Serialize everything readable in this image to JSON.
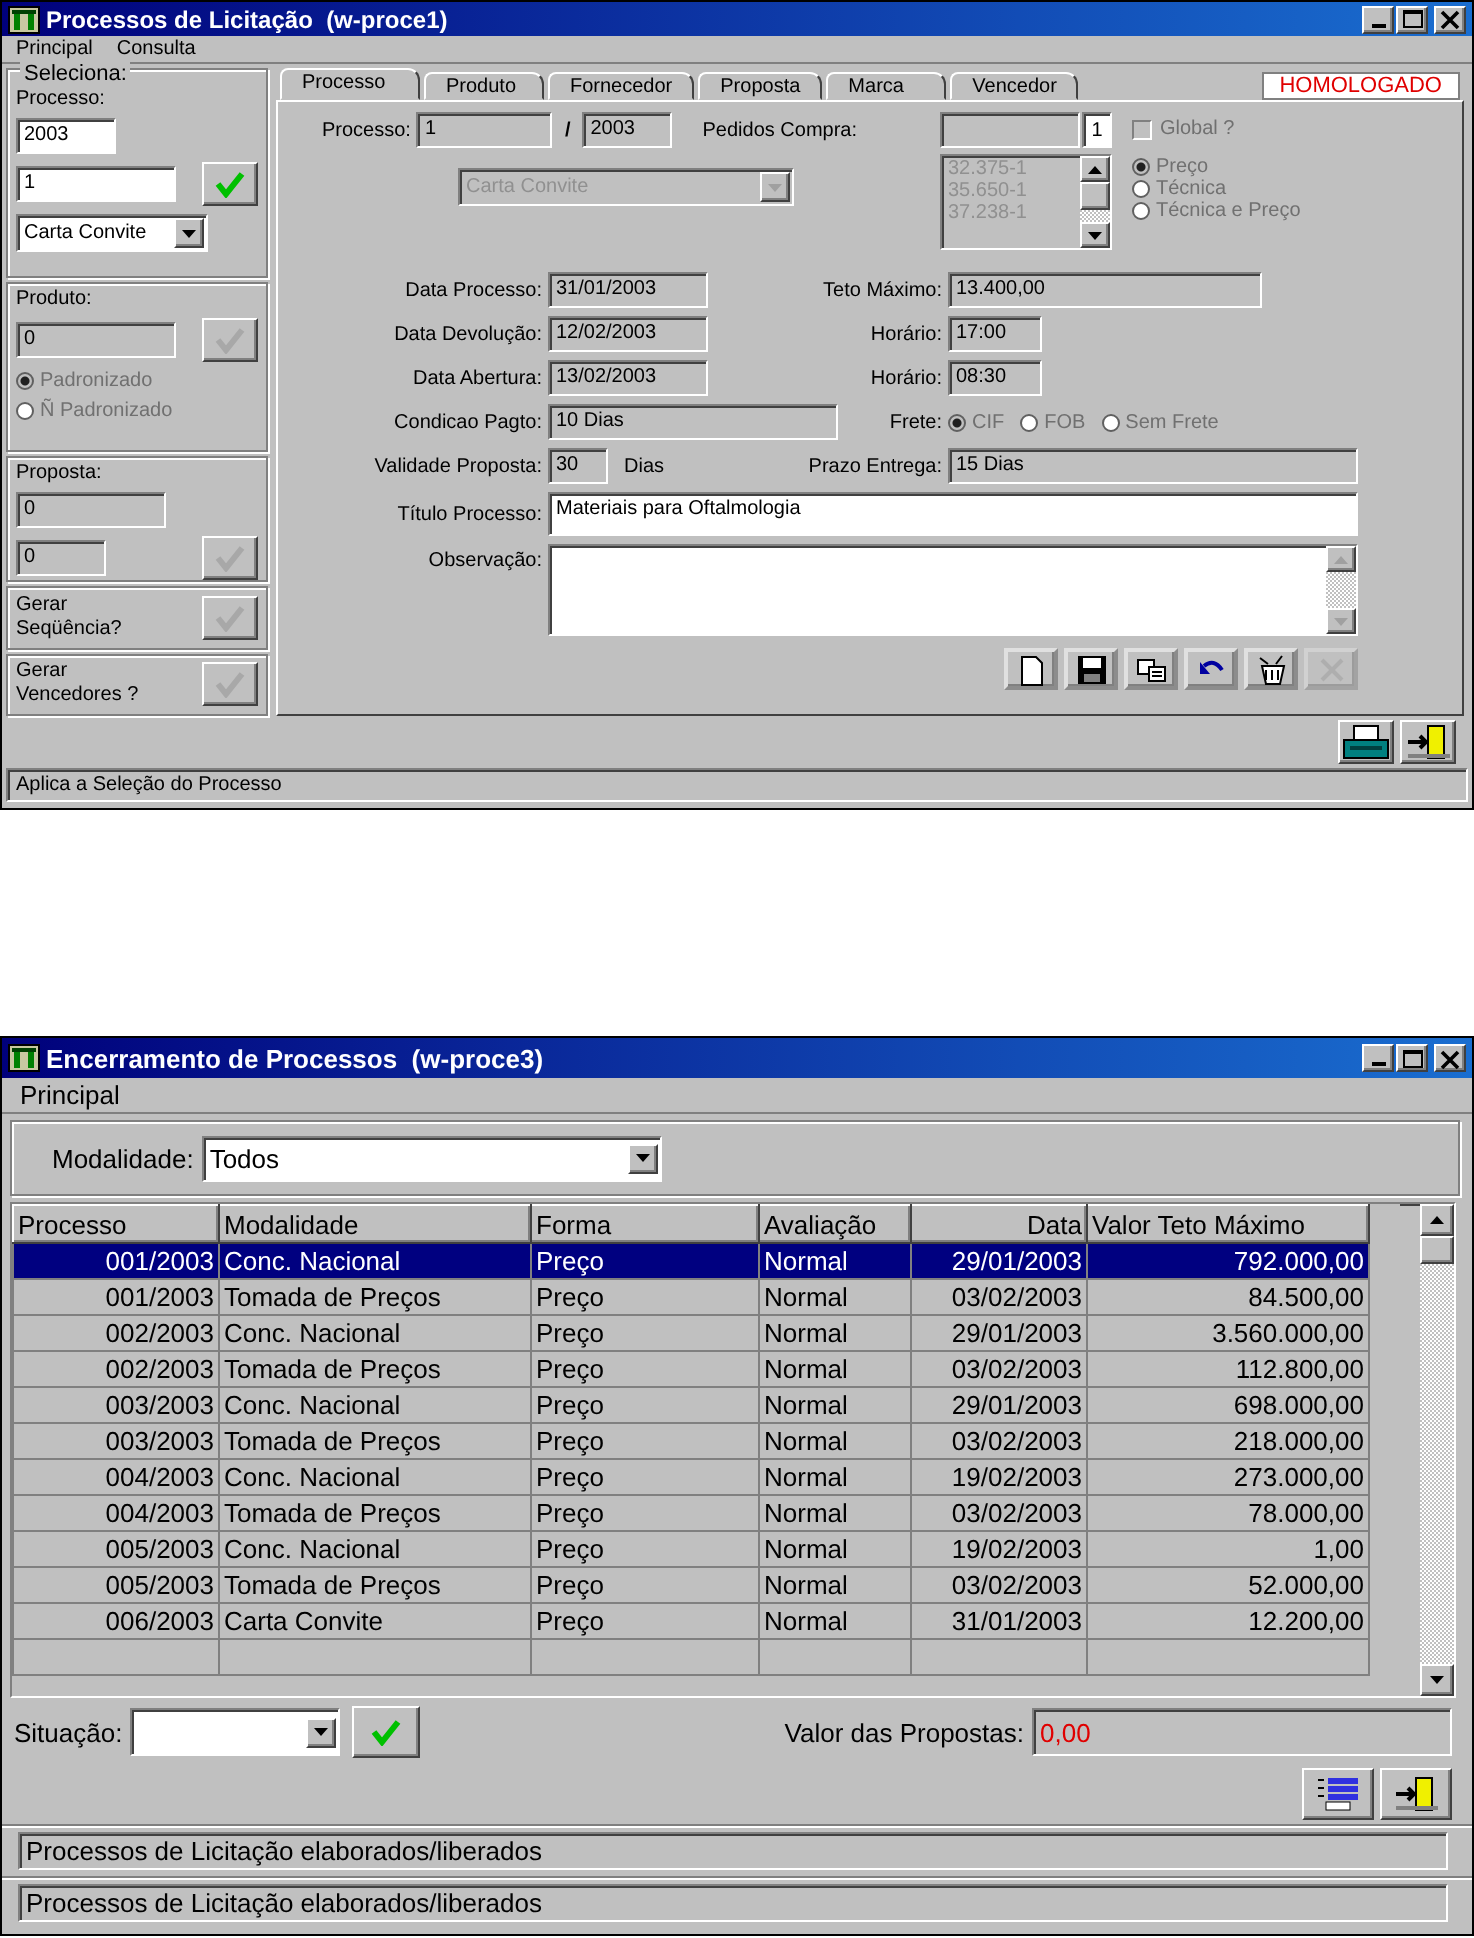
{
  "top_window": {
    "title": "Processos de Licitação  (w-proce1)",
    "menu": [
      "Principal",
      "Consulta"
    ],
    "select_panel": {
      "legend": "Seleciona:",
      "processo_label": "Processo:",
      "processo_value": "2003",
      "number_value": "1",
      "modalidade_value": "Carta Convite"
    },
    "produto_panel": {
      "label": "Produto:",
      "value": "0",
      "apply_disabled": true,
      "options": [
        {
          "label": "Padronizado",
          "selected": true
        },
        {
          "label": "Ñ Padronizado",
          "selected": false
        }
      ]
    },
    "proposta_panel": {
      "label": "Proposta:",
      "value_1": "0",
      "value_2": "0",
      "apply_disabled": true
    },
    "actions": [
      {
        "label": "Gerar\nSeqüência?",
        "disabled": true
      },
      {
        "label": "Gerar\nVencedores ?",
        "disabled": true
      }
    ],
    "tabs": [
      {
        "label": "Processo",
        "selected": true
      },
      {
        "label": "Produto",
        "selected": false
      },
      {
        "label": "Fornecedor",
        "selected": false
      },
      {
        "label": "Proposta",
        "selected": false
      },
      {
        "label": "Marca",
        "selected": false
      },
      {
        "label": "Vencedor",
        "selected": false
      }
    ],
    "status_badge": "HOMOLOGADO",
    "form": {
      "processo_label": "Processo:",
      "processo_number": "1",
      "separator": "/",
      "processo_year": "2003",
      "pedidos_label": "Pedidos Compra:",
      "pedidos_count": "1",
      "pedidos_list": [
        "32.375-1",
        "35.650-1",
        "37.238-1"
      ],
      "global": {
        "label": "Global ?",
        "checked": false
      },
      "modalidade": "Carta Convite",
      "avaliacao": [
        {
          "label": "Preço",
          "selected": true
        },
        {
          "label": "Técnica",
          "selected": false
        },
        {
          "label": "Técnica e Preço",
          "selected": false
        }
      ],
      "rows": [
        {
          "kind": "date",
          "label": "Data Processo:",
          "value": "31/01/2003",
          "right": {
            "kind": "money",
            "label": "Teto Máximo:",
            "value": "13.400,00"
          }
        },
        {
          "kind": "date",
          "label": "Data Devolução:",
          "value": "12/02/2003",
          "right": {
            "kind": "time",
            "label": "Horário:",
            "value": "17:00"
          }
        },
        {
          "kind": "date",
          "label": "Data Abertura:",
          "value": "13/02/2003",
          "right": {
            "kind": "time",
            "label": "Horário:",
            "value": "08:30"
          }
        },
        {
          "kind": "text",
          "label": "Condicao Pagto:",
          "value": "10 Dias",
          "right": {
            "kind": "radios",
            "label": "Frete:",
            "options": [
              {
                "label": "CIF",
                "selected": true
              },
              {
                "label": "FOB",
                "selected": false
              },
              {
                "label": "Sem Frete",
                "selected": false
              }
            ]
          }
        },
        {
          "kind": "days",
          "label": "Validade Proposta:",
          "value": "30",
          "unit": "Dias",
          "right": {
            "kind": "wide",
            "label": "Prazo Entrega:",
            "value": "15 Dias"
          }
        },
        {
          "kind": "title",
          "label": "Título Processo:",
          "value": "Materiais para Oftalmologia"
        },
        {
          "kind": "memo",
          "label": "Observação:"
        }
      ]
    },
    "toolbar": [
      {
        "kind": "new",
        "disabled": false
      },
      {
        "kind": "save",
        "disabled": false
      },
      {
        "kind": "copy",
        "disabled": false
      },
      {
        "kind": "undo",
        "disabled": false
      },
      {
        "kind": "delete",
        "disabled": false
      },
      {
        "kind": "cancel",
        "disabled": true
      }
    ],
    "footer_buttons": [
      {
        "kind": "print"
      },
      {
        "kind": "exit"
      }
    ],
    "status": "Aplica a Seleção do Processo"
  },
  "bottom_window": {
    "title": "Encerramento de Processos  (w-proce3)",
    "menu": [
      "Principal"
    ],
    "filter": {
      "label": "Modalidade:",
      "value": "Todos"
    },
    "columns": [
      "Processo",
      "Modalidade",
      "Forma",
      "Avaliação",
      "Data",
      "Valor Teto Máximo"
    ],
    "rows": [
      {
        "cells": [
          "001/2003",
          "Conc. Nacional",
          "Preço",
          "Normal",
          "29/01/2003",
          "792.000,00"
        ],
        "selected": true
      },
      {
        "cells": [
          "001/2003",
          "Tomada de Preços",
          "Preço",
          "Normal",
          "03/02/2003",
          "84.500,00"
        ],
        "selected": false
      },
      {
        "cells": [
          "002/2003",
          "Conc. Nacional",
          "Preço",
          "Normal",
          "29/01/2003",
          "3.560.000,00"
        ],
        "selected": false
      },
      {
        "cells": [
          "002/2003",
          "Tomada de Preços",
          "Preço",
          "Normal",
          "03/02/2003",
          "112.800,00"
        ],
        "selected": false
      },
      {
        "cells": [
          "003/2003",
          "Conc. Nacional",
          "Preço",
          "Normal",
          "29/01/2003",
          "698.000,00"
        ],
        "selected": false
      },
      {
        "cells": [
          "003/2003",
          "Tomada de Preços",
          "Preço",
          "Normal",
          "03/02/2003",
          "218.000,00"
        ],
        "selected": false
      },
      {
        "cells": [
          "004/2003",
          "Conc. Nacional",
          "Preço",
          "Normal",
          "19/02/2003",
          "273.000,00"
        ],
        "selected": false
      },
      {
        "cells": [
          "004/2003",
          "Tomada de Preços",
          "Preço",
          "Normal",
          "03/02/2003",
          "78.000,00"
        ],
        "selected": false
      },
      {
        "cells": [
          "005/2003",
          "Conc. Nacional",
          "Preço",
          "Normal",
          "19/02/2003",
          "1,00"
        ],
        "selected": false
      },
      {
        "cells": [
          "005/2003",
          "Tomada de Preços",
          "Preço",
          "Normal",
          "03/02/2003",
          "52.000,00"
        ],
        "selected": false
      },
      {
        "cells": [
          "006/2003",
          "Carta Convite",
          "Preço",
          "Normal",
          "31/01/2003",
          "12.200,00"
        ],
        "selected": false
      }
    ],
    "situacao_label": "Situação:",
    "proposals": {
      "label": "Valor das Propostas:",
      "value": "0,00"
    },
    "footer_buttons": [
      {
        "kind": "report"
      },
      {
        "kind": "exit"
      }
    ],
    "status_lines": [
      "Processos de Licitação elaborados/liberados",
      "Processos de Licitação elaborados/liberados"
    ]
  }
}
